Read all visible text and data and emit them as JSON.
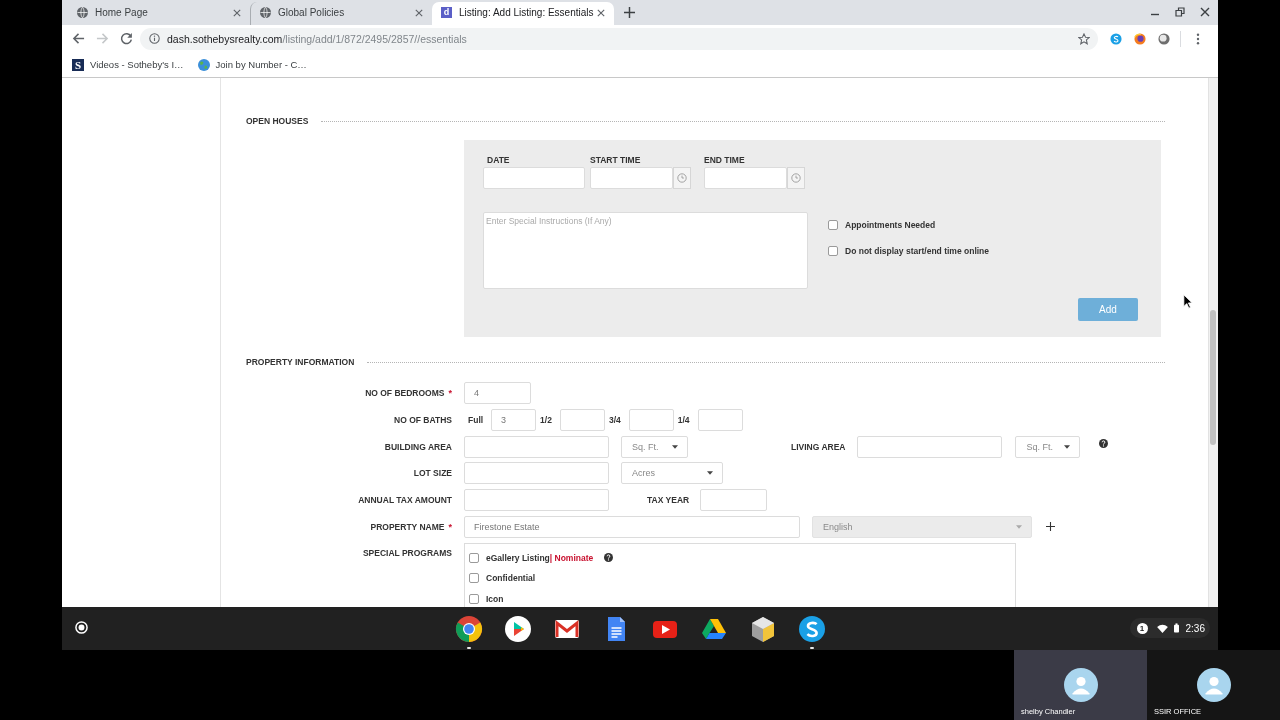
{
  "browser": {
    "tabs": [
      {
        "title": "Home Page",
        "favicon": {
          "kind": "globe"
        },
        "selected": false
      },
      {
        "title": "Global Policies",
        "favicon": {
          "kind": "globe"
        },
        "selected": false
      },
      {
        "title": "Listing: Add Listing: Essentials",
        "favicon": {
          "kind": "letter",
          "text": "d"
        },
        "selected": true
      }
    ],
    "nav": [
      {
        "kind": "back",
        "disabled": false
      },
      {
        "kind": "forward",
        "disabled": true
      },
      {
        "kind": "reload",
        "disabled": false
      }
    ],
    "address": {
      "host": "dash.sothebysrealty.com",
      "path": "/listing/add/1/872/2495/2857//essentials"
    },
    "bookmarks": [
      {
        "title": "Videos - Sotheby's I…",
        "favicon": {
          "kind": "letter",
          "text": "S"
        }
      },
      {
        "title": "Join by Number - C…",
        "favicon": {
          "kind": "earth"
        }
      }
    ]
  },
  "page": {
    "open_houses": {
      "heading": "OPEN HOUSES",
      "columns": [
        {
          "label": "DATE",
          "kind": "date"
        },
        {
          "label": "START TIME",
          "kind": "time"
        },
        {
          "label": "END TIME",
          "kind": "time"
        }
      ],
      "instructions": {
        "placeholder": "Enter Special Instructions (If Any)"
      },
      "options": [
        {
          "label": "Appointments Needed",
          "checked": false
        },
        {
          "label": "Do not display start/end time online",
          "checked": false
        }
      ],
      "add_button": "Add"
    },
    "property_information": {
      "heading": "PROPERTY INFORMATION",
      "rows": [
        {
          "kind": "single",
          "label": "NO OF BEDROOMS",
          "required_mark": "*",
          "value": "4"
        },
        {
          "kind": "baths",
          "label": "NO OF BATHS",
          "parts": [
            {
              "label": "Full",
              "value": "3"
            },
            {
              "label": "1/2"
            },
            {
              "label": "3/4"
            },
            {
              "label": "1/4"
            }
          ]
        },
        {
          "kind": "area",
          "label": "BUILDING AREA",
          "unit": "Sq. Ft.",
          "second": {
            "label": "LIVING AREA",
            "unit": "Sq. Ft."
          },
          "help": true
        },
        {
          "kind": "lot",
          "label": "LOT SIZE",
          "unit": "Acres"
        },
        {
          "kind": "tax",
          "label": "ANNUAL TAX AMOUNT",
          "second": {
            "label": "TAX YEAR"
          }
        },
        {
          "kind": "name",
          "label": "PROPERTY NAME",
          "required_mark": "*",
          "value": "Firestone Estate",
          "language": {
            "value": "English",
            "disabled": true
          }
        },
        {
          "kind": "programs",
          "label": "SPECIAL PROGRAMS",
          "programs": [
            {
              "label": "eGallery Listing",
              "checked": false,
              "link": "| Nominate",
              "help": true
            },
            {
              "label": "Confidential",
              "checked": false
            },
            {
              "label": "Icon",
              "checked": false
            }
          ]
        }
      ]
    }
  },
  "taskbar": {
    "apps": [
      {
        "kind": "chrome",
        "running": true
      },
      {
        "kind": "play_store",
        "running": false
      },
      {
        "kind": "gmail",
        "running": false
      },
      {
        "kind": "docs",
        "running": false
      },
      {
        "kind": "youtube",
        "running": false
      },
      {
        "kind": "drive",
        "running": false
      },
      {
        "kind": "files",
        "running": false
      },
      {
        "kind": "skype",
        "running": true
      }
    ],
    "notifications": "1",
    "time": "2:36"
  },
  "call": {
    "participants": [
      {
        "name": "shelby Chandler",
        "active": true
      },
      {
        "name": "SSIR OFFICE",
        "active": false
      }
    ]
  }
}
